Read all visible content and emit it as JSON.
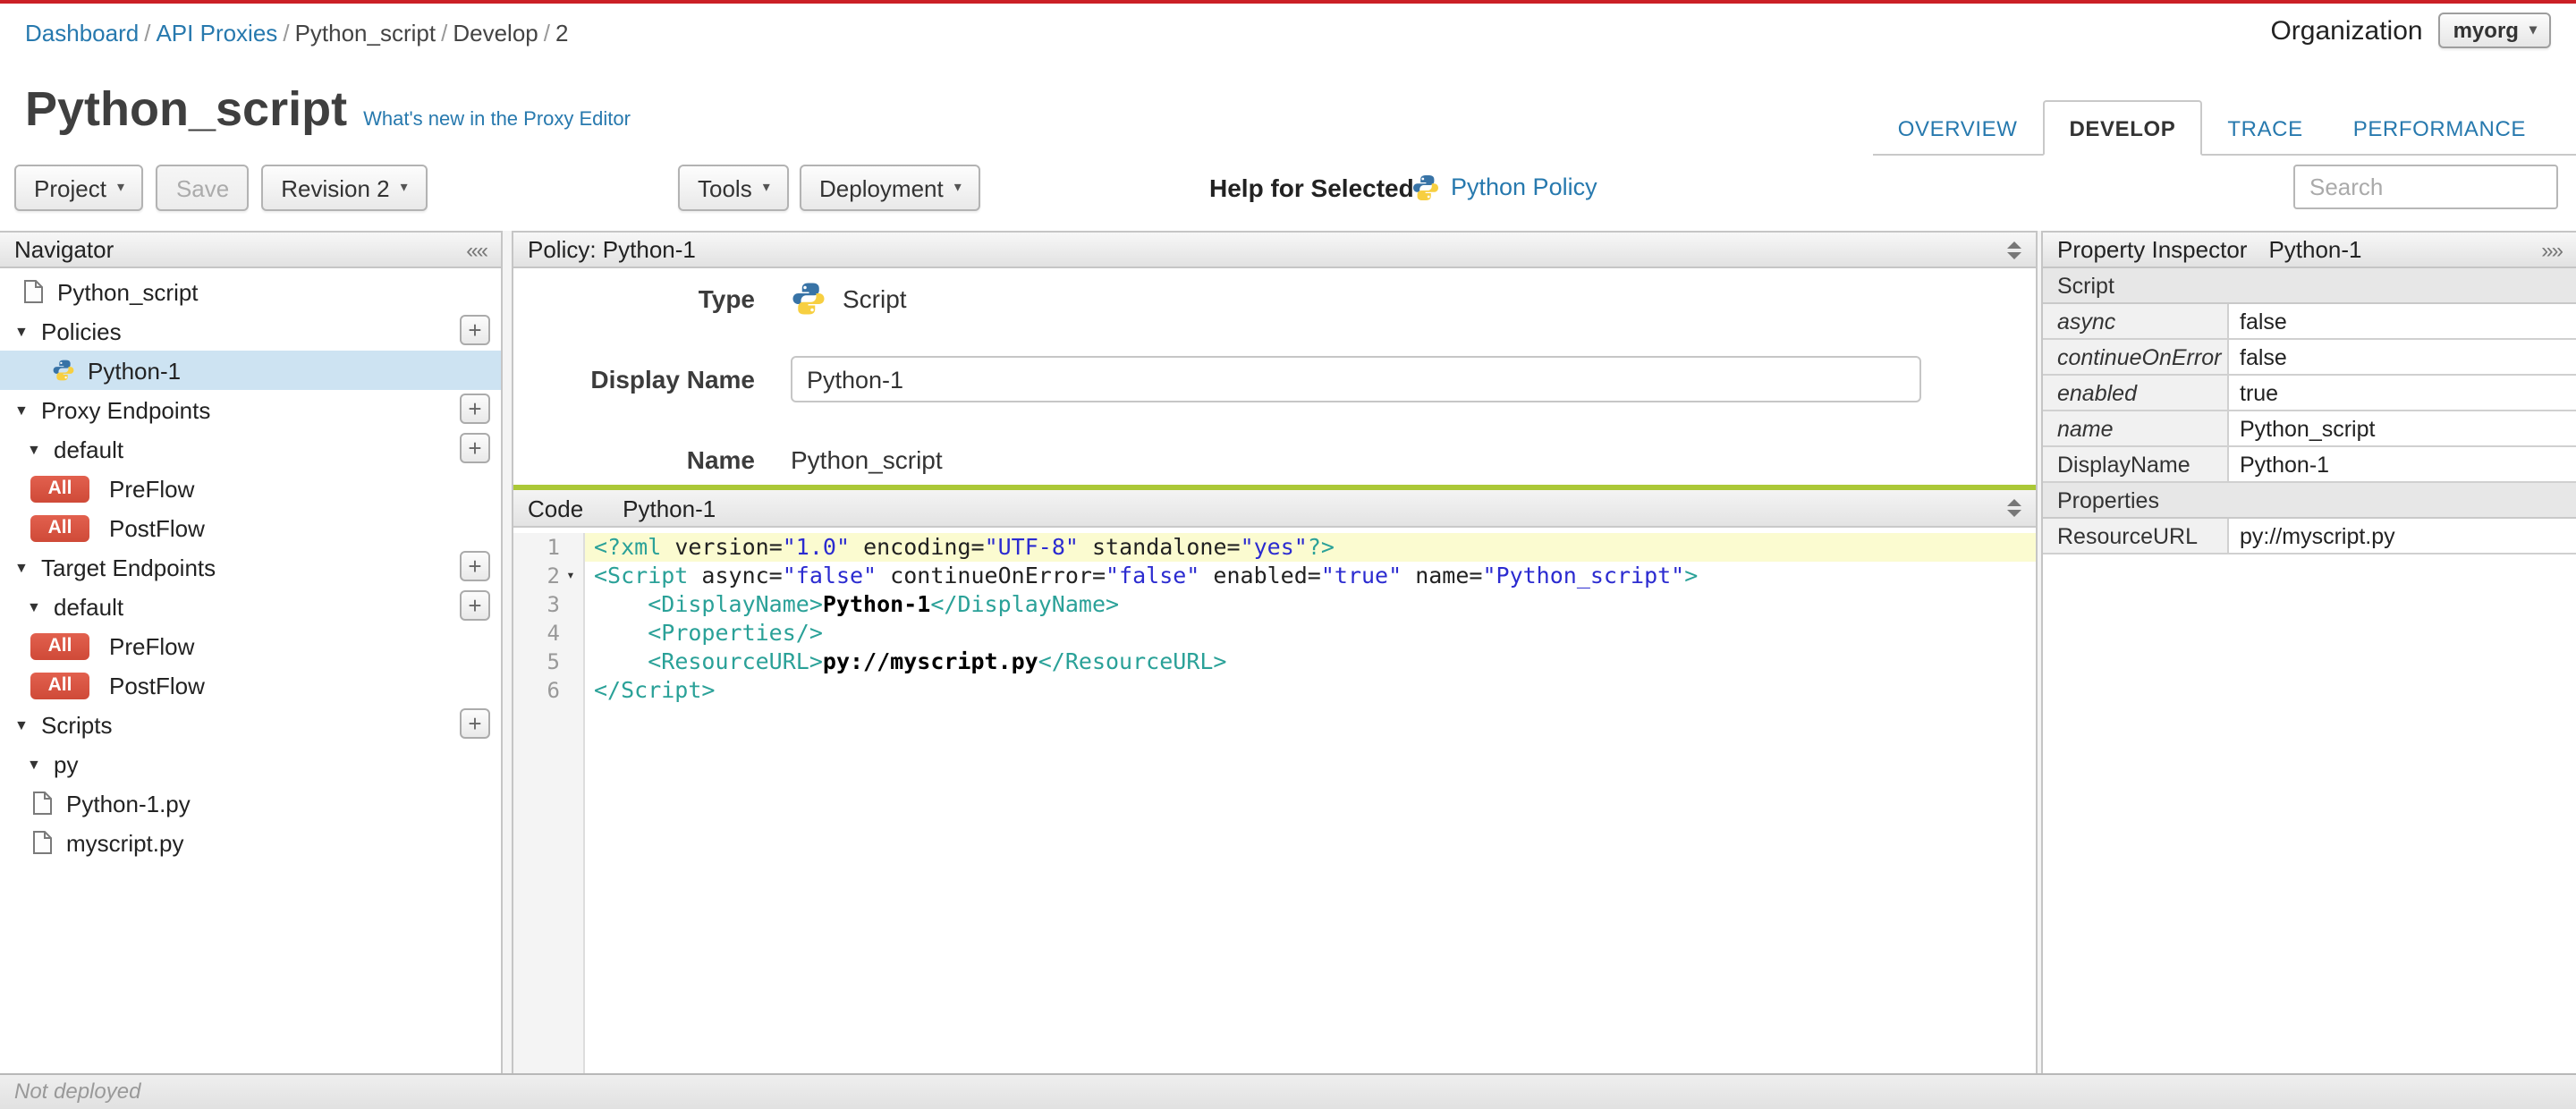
{
  "breadcrumb": {
    "items": [
      {
        "label": "Dashboard",
        "link": true
      },
      {
        "label": "API Proxies",
        "link": true
      },
      {
        "label": "Python_script",
        "link": false
      },
      {
        "label": "Develop",
        "link": false
      },
      {
        "label": "2",
        "link": false
      }
    ]
  },
  "org": {
    "label": "Organization",
    "value": "myorg"
  },
  "page": {
    "title": "Python_script",
    "whats_new": "What's new in the Proxy Editor"
  },
  "tabs": {
    "items": [
      {
        "label": "OVERVIEW",
        "active": false
      },
      {
        "label": "DEVELOP",
        "active": true
      },
      {
        "label": "TRACE",
        "active": false
      },
      {
        "label": "PERFORMANCE",
        "active": false
      }
    ]
  },
  "toolbar": {
    "project": "Project",
    "save": "Save",
    "revision": "Revision 2",
    "tools": "Tools",
    "deployment": "Deployment",
    "help_label": "Help for Selected",
    "help_link": "Python Policy",
    "search_placeholder": "Search"
  },
  "navigator": {
    "title": "Navigator",
    "items": [
      {
        "label": "Python_script",
        "icon": "file",
        "indent": "root"
      },
      {
        "label": "Policies",
        "icon": "tri",
        "indent": "section",
        "plus": true
      },
      {
        "label": "Python-1",
        "icon": "python",
        "indent": "child",
        "selected": true
      },
      {
        "label": "Proxy Endpoints",
        "icon": "tri",
        "indent": "section",
        "plus": true
      },
      {
        "label": "default",
        "icon": "tri",
        "indent": "sub",
        "plus": true
      },
      {
        "label": "PreFlow",
        "icon": "badge",
        "badge": "All",
        "indent": "flow"
      },
      {
        "label": "PostFlow",
        "icon": "badge",
        "badge": "All",
        "indent": "flow"
      },
      {
        "label": "Target Endpoints",
        "icon": "tri",
        "indent": "section",
        "plus": true
      },
      {
        "label": "default",
        "icon": "tri",
        "indent": "sub",
        "plus": true
      },
      {
        "label": "PreFlow",
        "icon": "badge",
        "badge": "All",
        "indent": "flow"
      },
      {
        "label": "PostFlow",
        "icon": "badge",
        "badge": "All",
        "indent": "flow"
      },
      {
        "label": "Scripts",
        "icon": "tri",
        "indent": "section",
        "plus": true
      },
      {
        "label": "py",
        "icon": "tri",
        "indent": "sub"
      },
      {
        "label": "Python-1.py",
        "icon": "file",
        "indent": "flow"
      },
      {
        "label": "myscript.py",
        "icon": "file",
        "indent": "flow"
      }
    ]
  },
  "policy": {
    "title": "Policy: Python-1",
    "type_label": "Type",
    "type_value": "Script",
    "display_name_label": "Display Name",
    "display_name_value": "Python-1",
    "name_label": "Name",
    "name_value": "Python_script"
  },
  "code": {
    "tab_label": "Code",
    "title": "Python-1",
    "active_line": 1,
    "fold_line": 2,
    "lines": [
      [
        [
          "tag",
          "<?xml"
        ],
        [
          "attr",
          " version="
        ],
        [
          "str",
          "\"1.0\""
        ],
        [
          "attr",
          " encoding="
        ],
        [
          "str",
          "\"UTF-8\""
        ],
        [
          "attr",
          " standalone="
        ],
        [
          "str",
          "\"yes\""
        ],
        [
          "tag",
          "?>"
        ]
      ],
      [
        [
          "tag",
          "<Script"
        ],
        [
          "attr",
          " async="
        ],
        [
          "str",
          "\"false\""
        ],
        [
          "attr",
          " continueOnError="
        ],
        [
          "str",
          "\"false\""
        ],
        [
          "attr",
          " enabled="
        ],
        [
          "str",
          "\"true\""
        ],
        [
          "attr",
          " name="
        ],
        [
          "str",
          "\"Python_script\""
        ],
        [
          "tag",
          ">"
        ]
      ],
      [
        [
          "plain",
          "    "
        ],
        [
          "tag",
          "<DisplayName>"
        ],
        [
          "text",
          "Python-1"
        ],
        [
          "tag",
          "</DisplayName>"
        ]
      ],
      [
        [
          "plain",
          "    "
        ],
        [
          "tag",
          "<Properties/>"
        ]
      ],
      [
        [
          "plain",
          "    "
        ],
        [
          "tag",
          "<ResourceURL>"
        ],
        [
          "text",
          "py://myscript.py"
        ],
        [
          "tag",
          "</ResourceURL>"
        ]
      ],
      [
        [
          "tag",
          "</Script>"
        ]
      ]
    ]
  },
  "inspector": {
    "title": "Property Inspector",
    "subtitle": "Python-1",
    "rows": [
      {
        "type": "section",
        "key": "Script"
      },
      {
        "type": "prop",
        "key": "async",
        "value": "false",
        "italic": true
      },
      {
        "type": "prop",
        "key": "continueOnError",
        "value": "false",
        "italic": true
      },
      {
        "type": "prop",
        "key": "enabled",
        "value": "true",
        "italic": true
      },
      {
        "type": "prop",
        "key": "name",
        "value": "Python_script",
        "italic": true
      },
      {
        "type": "prop",
        "key": "DisplayName",
        "value": "Python-1",
        "italic": false
      },
      {
        "type": "section",
        "key": "Properties"
      },
      {
        "type": "prop",
        "key": "ResourceURL",
        "value": "py://myscript.py",
        "italic": false
      }
    ]
  },
  "status": {
    "text": "Not deployed"
  },
  "colors": {
    "accent_red": "#cb2026",
    "link_blue": "#2779ae",
    "badge_red": "#d9534f",
    "code_green": "#abc837",
    "selected_blue": "#cde3f2"
  }
}
